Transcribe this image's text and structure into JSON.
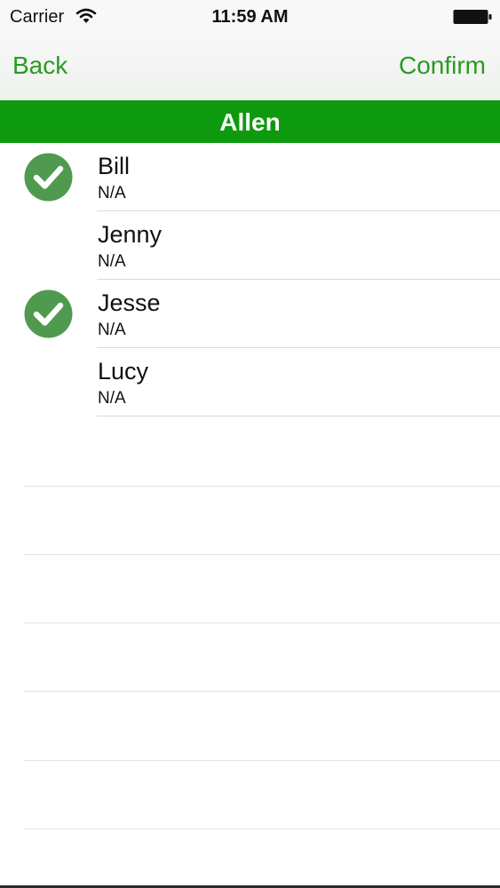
{
  "status_bar": {
    "carrier": "Carrier",
    "time": "11:59 AM",
    "wifi_icon": "wifi-icon",
    "battery_icon": "battery-icon"
  },
  "nav": {
    "back_label": "Back",
    "confirm_label": "Confirm"
  },
  "header": {
    "title": "Allen"
  },
  "list": {
    "items": [
      {
        "name": "Bill",
        "subtitle": "N/A",
        "checked": true
      },
      {
        "name": "Jenny",
        "subtitle": "N/A",
        "checked": false
      },
      {
        "name": "Jesse",
        "subtitle": "N/A",
        "checked": true
      },
      {
        "name": "Lucy",
        "subtitle": "N/A",
        "checked": false
      }
    ]
  },
  "colors": {
    "accent": "#2a9b22",
    "header_bg": "#0e9a0e",
    "check_green": "#4f9a4f"
  }
}
